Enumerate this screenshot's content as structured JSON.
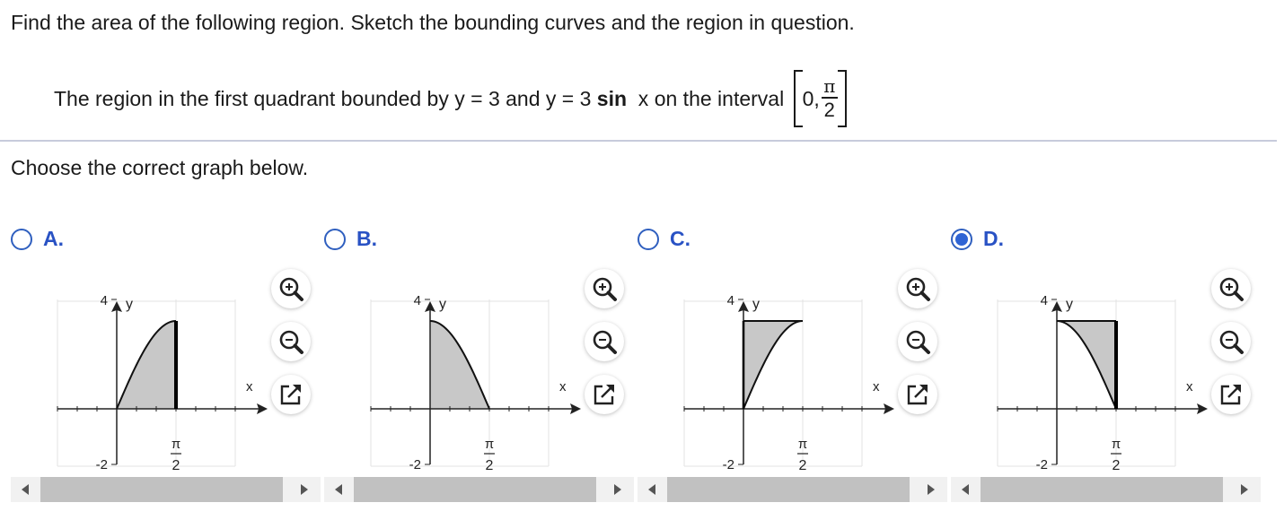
{
  "question": {
    "instruction": "Find the area of the following region. Sketch the bounding curves and the region in question.",
    "region_part1": "The region in the first quadrant bounded by y = 3 and y = 3 ",
    "region_bold": "sin",
    "region_part2": "  x on the interval ",
    "interval_start": "0,",
    "interval_num": "π",
    "interval_den": "2",
    "prompt": "Choose the correct graph below."
  },
  "options": [
    {
      "letter": "A.",
      "selected": false,
      "shape": "under-sin"
    },
    {
      "letter": "B.",
      "selected": false,
      "shape": "under-cos"
    },
    {
      "letter": "C.",
      "selected": false,
      "shape": "between-3-and-3sin"
    },
    {
      "letter": "D.",
      "selected": true,
      "shape": "between-3-and-3cos"
    }
  ],
  "graph_labels": {
    "y_axis": "y",
    "x_axis": "x",
    "y_tick_top": "4",
    "y_tick_bottom": "-2",
    "x_tick_num": "π",
    "x_tick_den": "2"
  },
  "tool_icons": [
    "zoom-in-icon",
    "zoom-out-icon",
    "open-new-window-icon"
  ],
  "colors": {
    "accent": "#2952c4",
    "fill": "#c8c8c8",
    "radio": "#2f64d4"
  }
}
